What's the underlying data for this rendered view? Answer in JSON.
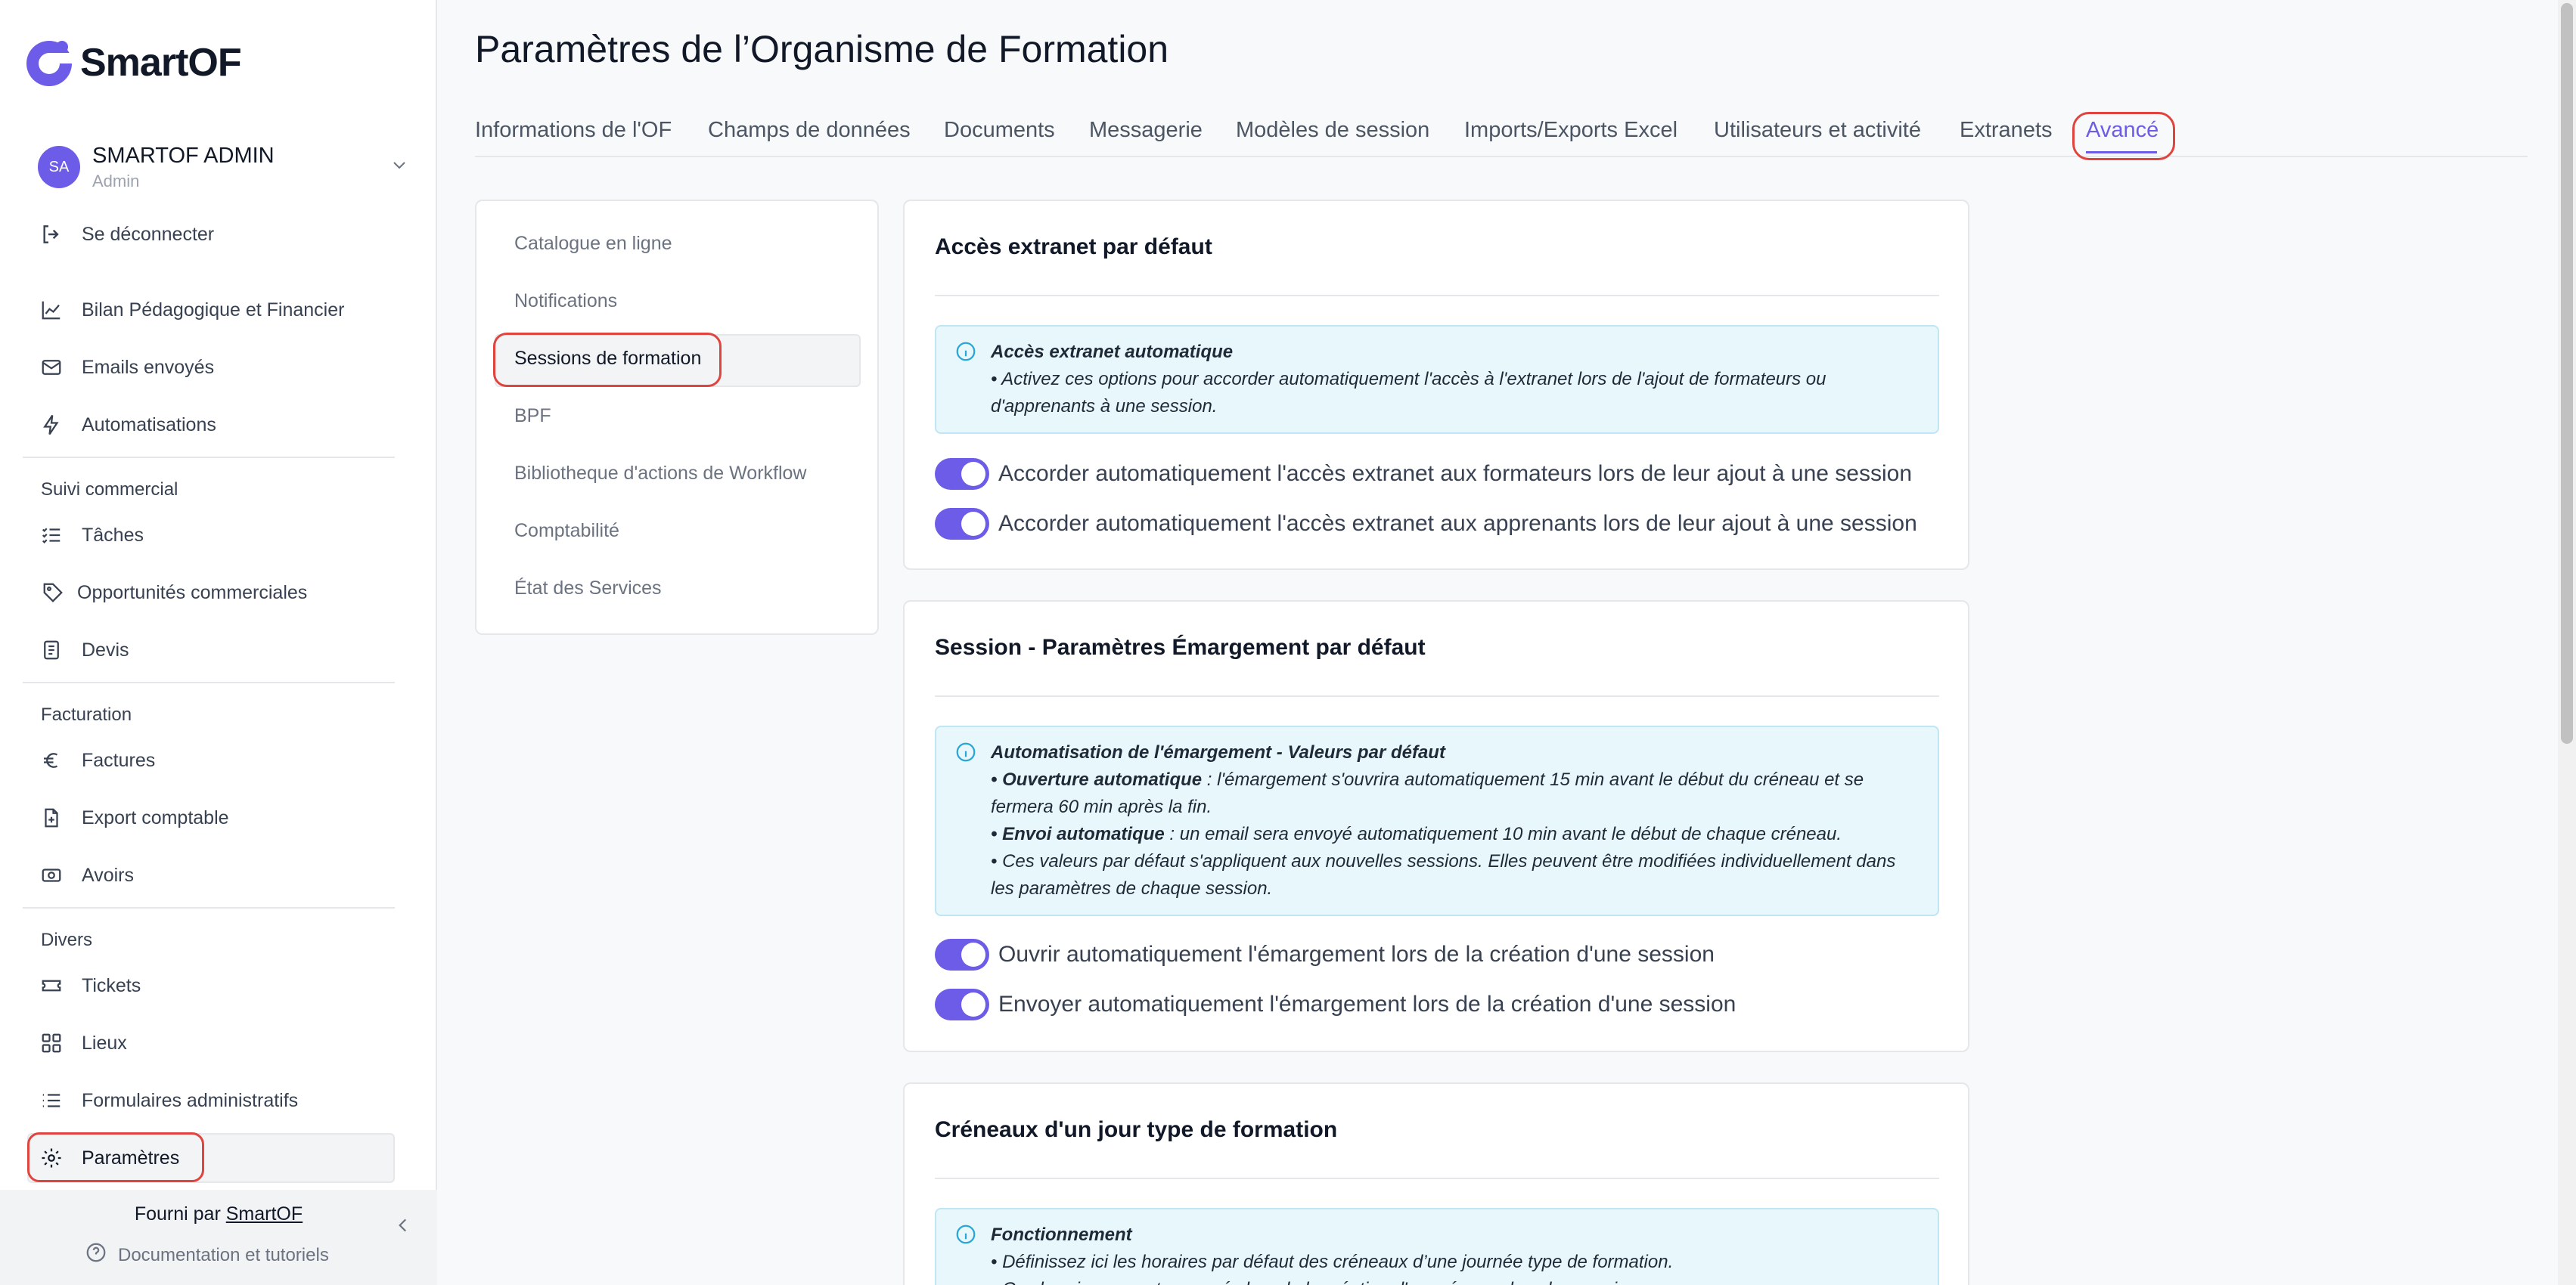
{
  "app": {
    "name": "SmartOF",
    "brand_color": "#6d5ce8"
  },
  "user": {
    "initials": "SA",
    "name": "SMARTOF ADMIN",
    "role": "Admin"
  },
  "sidebar": {
    "logout": "Se déconnecter",
    "items_top": [
      {
        "label": "Bilan Pédagogique et Financier",
        "icon": "chart-line-icon"
      },
      {
        "label": "Emails envoyés",
        "icon": "mail-icon"
      },
      {
        "label": "Automatisations",
        "icon": "bolt-icon"
      }
    ],
    "sections": [
      {
        "title": "Suivi commercial",
        "items": [
          {
            "label": "Tâches",
            "icon": "list-check-icon"
          },
          {
            "label": "Opportunités commerciales",
            "icon": "tag-icon"
          },
          {
            "label": "Devis",
            "icon": "document-icon"
          }
        ]
      },
      {
        "title": "Facturation",
        "items": [
          {
            "label": "Factures",
            "icon": "euro-icon"
          },
          {
            "label": "Export comptable",
            "icon": "file-export-icon"
          },
          {
            "label": "Avoirs",
            "icon": "banknote-icon"
          }
        ]
      },
      {
        "title": "Divers",
        "items": [
          {
            "label": "Tickets",
            "icon": "ticket-icon"
          },
          {
            "label": "Lieux",
            "icon": "grid-icon"
          },
          {
            "label": "Formulaires administratifs",
            "icon": "list-icon"
          },
          {
            "label": "Paramètres",
            "icon": "gear-icon",
            "active": true
          }
        ]
      }
    ],
    "footer": {
      "provided_by": "Fourni par",
      "provider_link": "SmartOF",
      "docs": "Documentation et tutoriels"
    }
  },
  "main": {
    "title": "Paramètres de l’Organisme de Formation",
    "tabs": [
      "Informations de l'OF",
      "Champs de données",
      "Documents",
      "Messagerie",
      "Modèles de session",
      "Imports/Exports Excel",
      "Utilisateurs et activité",
      "Extranets",
      "Avancé"
    ],
    "active_tab": "Avancé",
    "subnav": [
      "Catalogue en ligne",
      "Notifications",
      "Sessions de formation",
      "BPF",
      "Bibliotheque d'actions de Workflow",
      "Comptabilité",
      "État des Services"
    ],
    "active_subnav": "Sessions de formation",
    "cards": [
      {
        "title": "Accès extranet par défaut",
        "info": {
          "heading": "Accès extranet automatique",
          "lines": [
            "• Activez ces options pour accorder automatiquement l'accès à l'extranet lors de l'ajout de formateurs ou d'apprenants à une session."
          ]
        },
        "toggles": [
          {
            "label": "Accorder automatiquement l'accès extranet aux formateurs lors de leur ajout à une session",
            "on": true
          },
          {
            "label": "Accorder automatiquement l'accès extranet aux apprenants lors de leur ajout à une session",
            "on": true
          }
        ]
      },
      {
        "title": "Session - Paramètres Émargement par défaut",
        "info": {
          "heading": "Automatisation de l'émargement - Valeurs par défaut",
          "l1_bold": "• Ouverture automatique",
          "l1_rest": " : l'émargement s'ouvrira automatiquement 15 min avant le début du créneau et se fermera 60 min après la fin.",
          "l2_bold": "• Envoi automatique",
          "l2_rest": " : un email sera envoyé automatiquement 10 min avant le début de chaque créneau.",
          "l3": "• Ces valeurs par défaut s'appliquent aux nouvelles sessions. Elles peuvent être modifiées individuellement dans les paramètres de chaque session."
        },
        "toggles": [
          {
            "label": "Ouvrir automatiquement l'émargement lors de la création d'une session",
            "on": true
          },
          {
            "label": "Envoyer automatiquement l'émargement lors de la création d'une session",
            "on": true
          }
        ]
      },
      {
        "title": "Créneaux d'un jour type de formation",
        "info": {
          "heading": "Fonctionnement",
          "l1": "• Définissez ici les horaires par défaut des créneaux d’une journée type de formation.",
          "l2": "• Ces horaires seront proposés lors de la création d'un créneau dans les sessions."
        }
      }
    ]
  }
}
